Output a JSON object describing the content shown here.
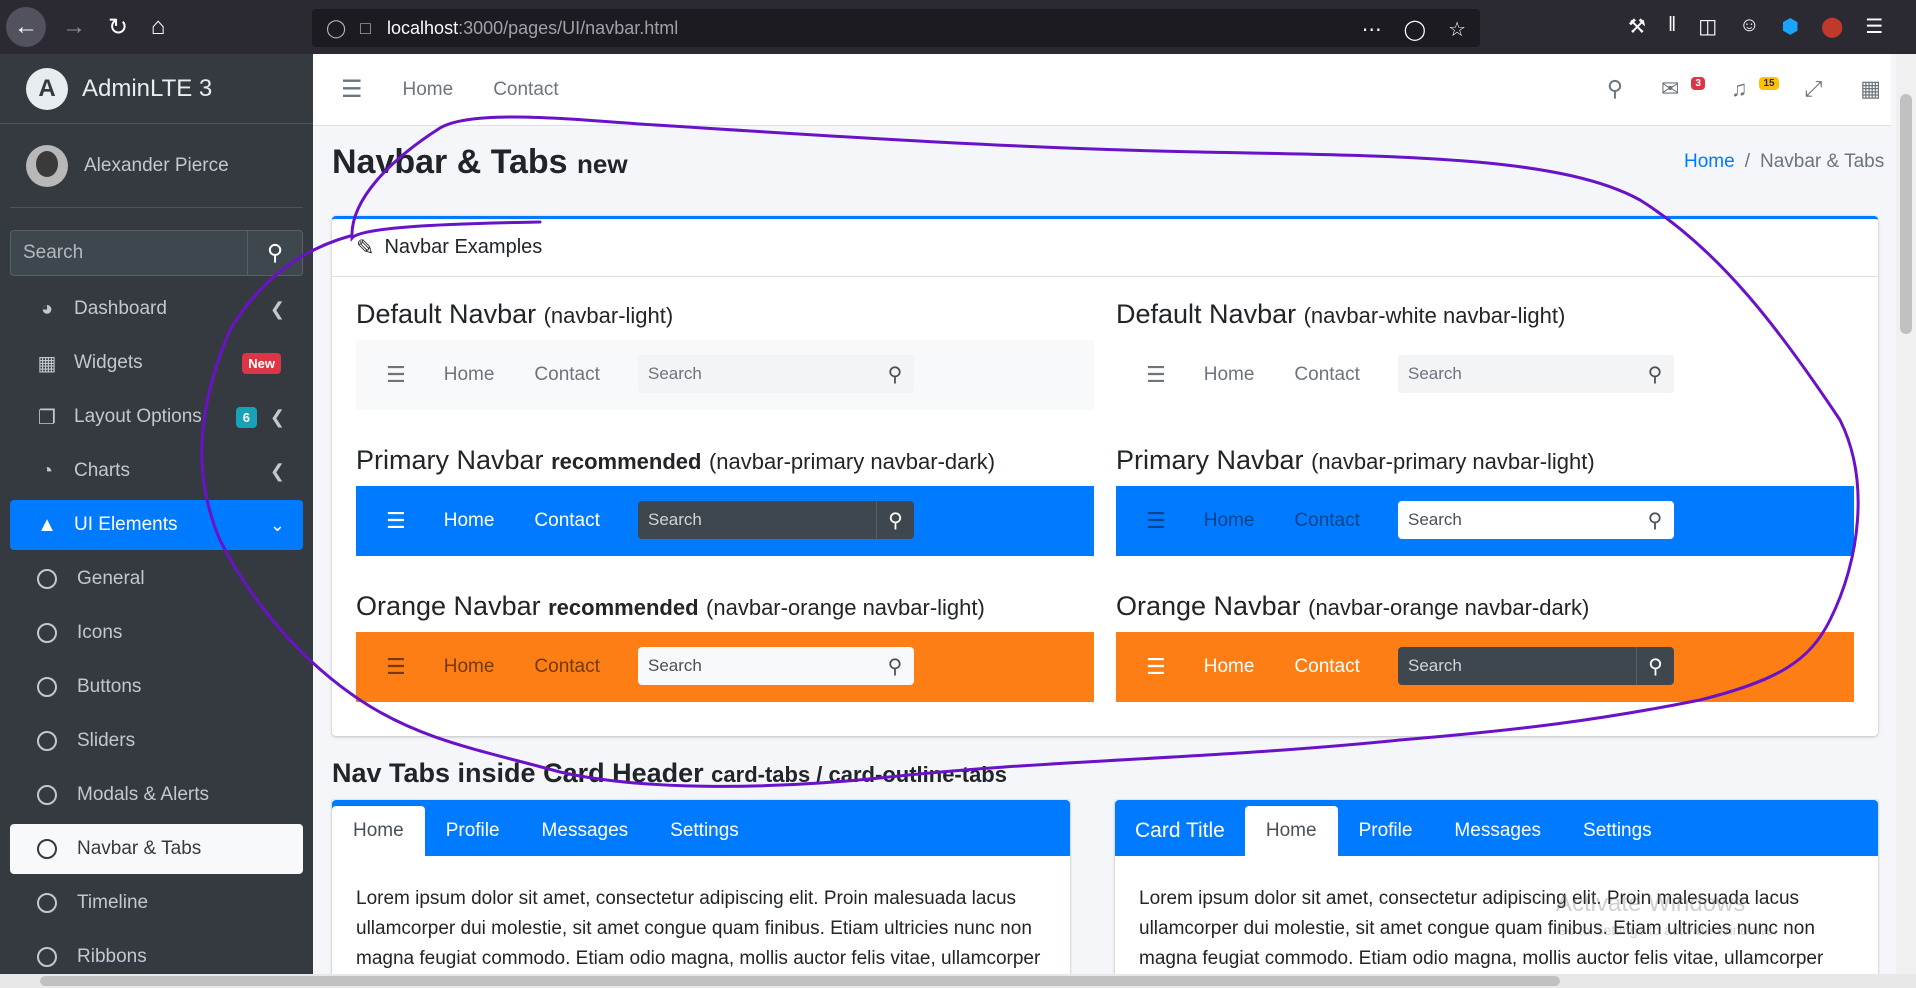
{
  "browser": {
    "url_host": "localhost",
    "url_path": ":3000/pages/UI/navbar.html"
  },
  "sidebar": {
    "brand": "AdminLTE 3",
    "user": "Alexander Pierce",
    "search_placeholder": "Search",
    "items": [
      {
        "label": "Dashboard"
      },
      {
        "label": "Widgets",
        "badge": "New"
      },
      {
        "label": "Layout Options",
        "badge": "6"
      },
      {
        "label": "Charts"
      },
      {
        "label": "UI Elements"
      },
      {
        "label": "General"
      },
      {
        "label": "Icons"
      },
      {
        "label": "Buttons"
      },
      {
        "label": "Sliders"
      },
      {
        "label": "Modals & Alerts"
      },
      {
        "label": "Navbar & Tabs"
      },
      {
        "label": "Timeline"
      },
      {
        "label": "Ribbons"
      }
    ]
  },
  "topnav": {
    "home": "Home",
    "contact": "Contact",
    "messages_count": "3",
    "notifications_count": "15"
  },
  "page": {
    "title": "Navbar & Tabs",
    "title_small": "new",
    "breadcrumb_home": "Home",
    "breadcrumb_sep": "/",
    "breadcrumb_current": "Navbar & Tabs"
  },
  "card": {
    "header": "Navbar Examples",
    "examples": [
      {
        "title": "Default Navbar",
        "bold": "",
        "sub": "(navbar-light)",
        "home": "Home",
        "contact": "Contact",
        "search": "Search"
      },
      {
        "title": "Default Navbar",
        "bold": "",
        "sub": "(navbar-white navbar-light)",
        "home": "Home",
        "contact": "Contact",
        "search": "Search"
      },
      {
        "title": "Primary Navbar",
        "bold": "recommended",
        "sub": "(navbar-primary navbar-dark)",
        "home": "Home",
        "contact": "Contact",
        "search": "Search"
      },
      {
        "title": "Primary Navbar",
        "bold": "",
        "sub": "(navbar-primary navbar-light)",
        "home": "Home",
        "contact": "Contact",
        "search": "Search"
      },
      {
        "title": "Orange Navbar",
        "bold": "recommended",
        "sub": "(navbar-orange navbar-light)",
        "home": "Home",
        "contact": "Contact",
        "search": "Search"
      },
      {
        "title": "Orange Navbar",
        "bold": "",
        "sub": "(navbar-orange navbar-dark)",
        "home": "Home",
        "contact": "Contact",
        "search": "Search"
      }
    ]
  },
  "tabs_section": {
    "title": "Nav Tabs inside Card Header",
    "title_small": "card-tabs / card-outline-tabs",
    "left_tabs": [
      "Home",
      "Profile",
      "Messages",
      "Settings"
    ],
    "right_card_title": "Card Title",
    "right_tabs": [
      "Home",
      "Profile",
      "Messages",
      "Settings"
    ],
    "body_text": "Lorem ipsum dolor sit amet, consectetur adipiscing elit. Proin malesuada lacus ullamcorper dui molestie, sit amet congue quam finibus. Etiam ultricies nunc non magna feugiat commodo. Etiam odio magna, mollis auctor felis vitae, ullamcorper"
  },
  "watermark": {
    "title": "Activate Windows",
    "sub": "Go to Settings to activate Windows."
  },
  "colors": {
    "primary": "#007bff",
    "orange": "#fd7e14",
    "sidebar": "#343a40",
    "annotation": "#6a12c8"
  }
}
